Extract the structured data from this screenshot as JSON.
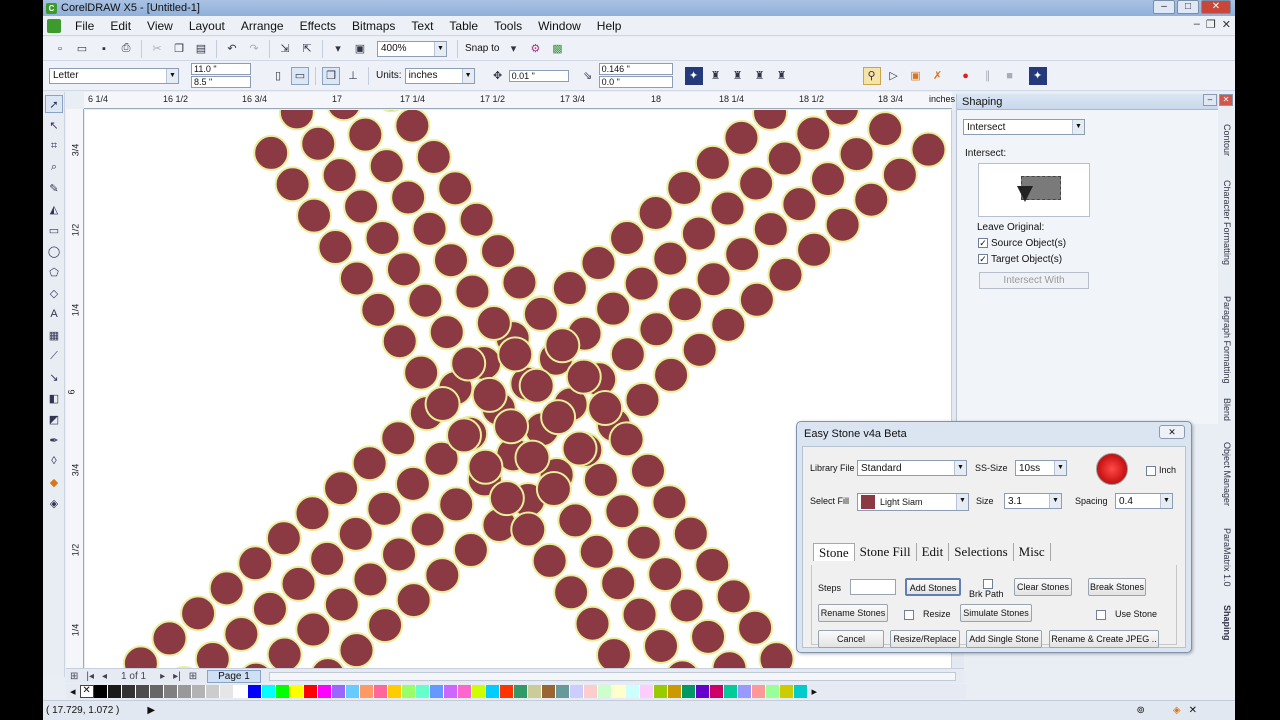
{
  "window": {
    "title": "CorelDRAW X5 - [Untitled-1]",
    "min": "–",
    "max": "□",
    "close": "✕"
  },
  "menu": [
    "File",
    "Edit",
    "View",
    "Layout",
    "Arrange",
    "Effects",
    "Bitmaps",
    "Text",
    "Table",
    "Tools",
    "Window",
    "Help"
  ],
  "toolbar1": {
    "zoom": "400%",
    "snap": "Snap to"
  },
  "toolbar2": {
    "paper": "Letter",
    "width": "11.0 \"",
    "height": "8.5 \"",
    "units_label": "Units:",
    "units": "inches",
    "nudge": "0.01 \"",
    "dup_x": "0.146 \"",
    "dup_y": "0.0 \""
  },
  "rulers": {
    "h_ticks": [
      "6 1/4",
      "16 1/2",
      "16 3/4",
      "17",
      "17 1/4",
      "17 1/2",
      "17 3/4",
      "18",
      "18 1/4",
      "18 1/2",
      "18 3/4"
    ],
    "unit": "inches",
    "v_ticks": [
      "3/4",
      "1/2",
      "1/4",
      "6",
      "3/4",
      "1/2",
      "1/4"
    ]
  },
  "page_nav": {
    "pages": "1 of 1",
    "tab": "Page 1"
  },
  "status": {
    "coords": "( 17.729, 1.072 )"
  },
  "palette": [
    "#000000",
    "#1a1a1a",
    "#333333",
    "#4d4d4d",
    "#666666",
    "#808080",
    "#999999",
    "#b3b3b3",
    "#cccccc",
    "#e6e6e6",
    "#ffffff",
    "#0000ff",
    "#00ffff",
    "#00ff00",
    "#ffff00",
    "#ff0000",
    "#ff00ff",
    "#9966ff",
    "#66ccff",
    "#ff9966",
    "#ff6699",
    "#ffcc00",
    "#99ff66",
    "#66ffcc",
    "#6699ff",
    "#cc66ff",
    "#ff66cc",
    "#ccff00",
    "#00ccff",
    "#ff3300",
    "#339966",
    "#cccc99",
    "#996633",
    "#669999",
    "#ccccff",
    "#ffcccc",
    "#ccffcc",
    "#ffffcc",
    "#ccffff",
    "#ffccff",
    "#99cc00",
    "#cc9900",
    "#009966",
    "#6600cc",
    "#cc0066",
    "#00cc99",
    "#9999ff",
    "#ff9999",
    "#99ff99",
    "#cccc00",
    "#00cccc"
  ],
  "shaping": {
    "title": "Shaping",
    "mode": "Intersect",
    "heading": "Intersect:",
    "leave_original": "Leave Original:",
    "source": "Source Object(s)",
    "target": "Target Object(s)",
    "button": "Intersect With"
  },
  "docker_tabs": [
    "Contour",
    "Character Formatting",
    "Paragraph Formatting",
    "Blend",
    "Object Manager",
    "ParaMatrix 1.0",
    "Shaping"
  ],
  "dialog": {
    "title": "Easy Stone v4a Beta",
    "library_label": "Library File",
    "library": "Standard",
    "ss_label": "SS-Size",
    "ss": "10ss",
    "inch": "Inch",
    "fill_label": "Select Fill",
    "fill": "Light Siam",
    "fill_color": "#8b3a44",
    "size_label": "Size",
    "size": "3.1",
    "spacing_label": "Spacing",
    "spacing": "0.4",
    "tabs": [
      "Stone",
      "Stone Fill",
      "Edit",
      "Selections",
      "Misc"
    ],
    "steps_label": "Steps",
    "buttons": {
      "add": "Add Stones",
      "brk": "Brk Path",
      "clear": "Clear Stones",
      "break": "Break Stones",
      "rename": "Rename Stones",
      "resize": "Resize",
      "simulate": "Simulate Stones",
      "use": "Use Stone",
      "cancel": "Cancel",
      "resize_replace": "Resize/Replace",
      "add_single": "Add Single Stone",
      "rename_jpeg": "Rename & Create JPEG .."
    }
  }
}
